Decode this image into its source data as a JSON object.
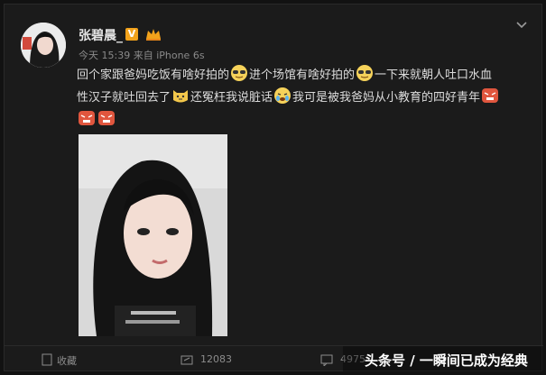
{
  "post": {
    "username": "张碧晨_",
    "verified_badge": "V",
    "meta": "今天 15:39 来自 iPhone 6s",
    "text_parts": [
      "回个家跟爸妈吃饭有啥好拍的",
      "进个场馆有啥好拍的",
      "一下来就朝人吐口水血",
      "性汉子就吐回去了",
      "还冤枉我说脏话",
      "我可是被我爸妈从小教育的四好青年"
    ]
  },
  "actions": {
    "favorite": "收藏",
    "repost_count": "12083",
    "comment_count": "4975"
  },
  "watermark": "头条号 / 一瞬间已成为经典",
  "colors": {
    "background": "#121212",
    "card": "#1b1b1b",
    "badge": "#f2a21b",
    "text": "#dcdcdc",
    "meta": "#8a8a8a"
  }
}
